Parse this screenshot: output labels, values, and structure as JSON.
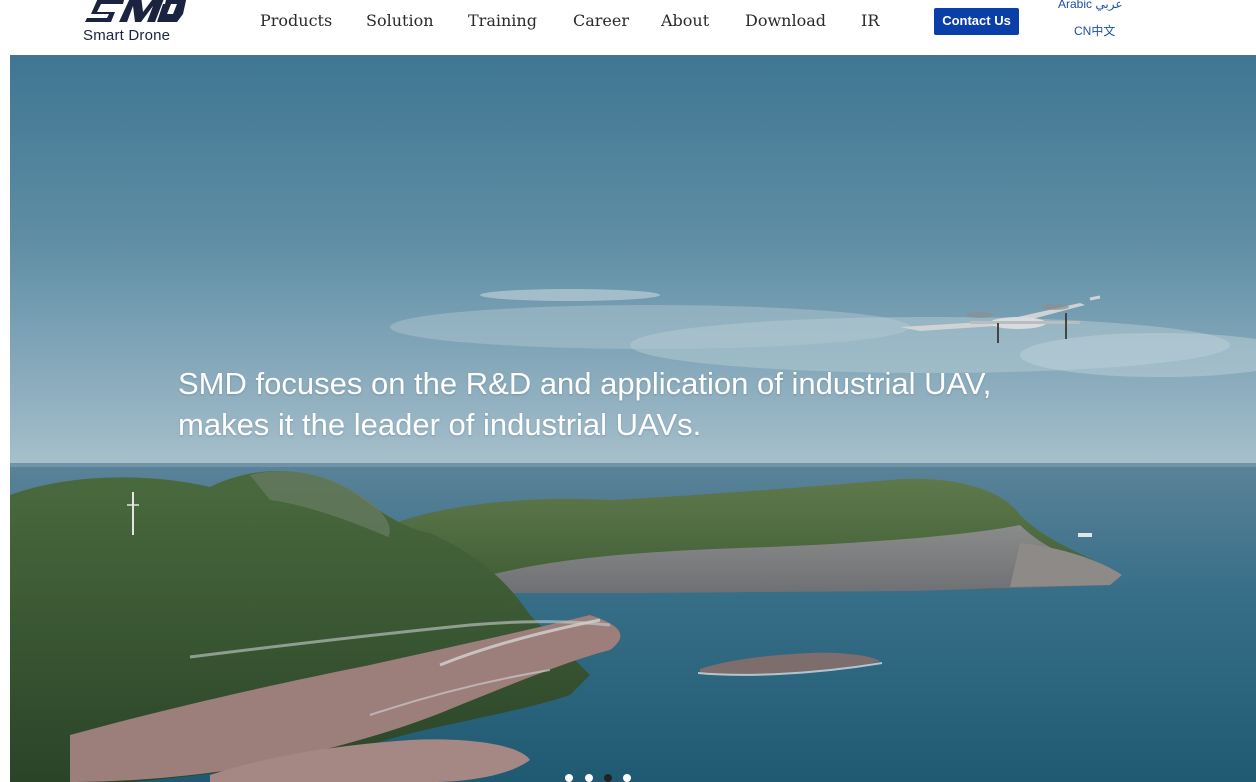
{
  "header": {
    "logo": {
      "mark_text": "SMD",
      "name": "Smart Drone",
      "color": "#1b2340"
    },
    "nav": [
      {
        "label": "Products"
      },
      {
        "label": "Solution"
      },
      {
        "label": "Training"
      },
      {
        "label": "Career"
      },
      {
        "label": "About"
      },
      {
        "label": "Download"
      },
      {
        "label": "IR"
      }
    ],
    "contact_button": {
      "label": "Contact Us",
      "color": "#0a3ea8"
    },
    "languages": [
      {
        "label": "Arabic عربي"
      },
      {
        "label": "CN中文"
      }
    ]
  },
  "hero": {
    "headline_line1": "SMD focuses on the R&D and application of industrial UAV,",
    "headline_line2": "makes it the leader of industrial UAVs.",
    "image_subject": "VTOL fixed-wing drone flying over a rocky coastal island",
    "slider": {
      "slide_count": 4,
      "active_index": 2
    }
  }
}
